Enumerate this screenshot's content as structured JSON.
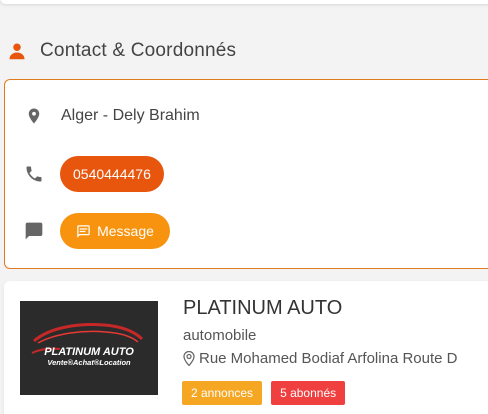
{
  "colors": {
    "accent_orange": "#e07b20",
    "phone_pill": "#e8560e",
    "message_pill": "#f7930e",
    "badge_ads": "#f5a623",
    "badge_subs": "#ef3f3f"
  },
  "contact_section": {
    "title": "Contact & Coordonnés",
    "icon": "person-icon"
  },
  "contact": {
    "location": {
      "icon": "location-pin-icon",
      "text": "Alger - Dely Brahim"
    },
    "phone": {
      "icon": "phone-icon",
      "label": "0540444476"
    },
    "message": {
      "icon": "chat-bubble-icon",
      "button_icon": "message-icon",
      "label": "Message"
    }
  },
  "business": {
    "logo": {
      "line1": "PLATINUM AUTO",
      "line2": "Vente®Achat®Location"
    },
    "name": "PLATINUM AUTO",
    "category": "automobile",
    "address": "Rue Mohamed Bodiaf Arfolina Route D",
    "badges": {
      "ads": "2 annonces",
      "subscribers": "5 abonnés"
    }
  }
}
